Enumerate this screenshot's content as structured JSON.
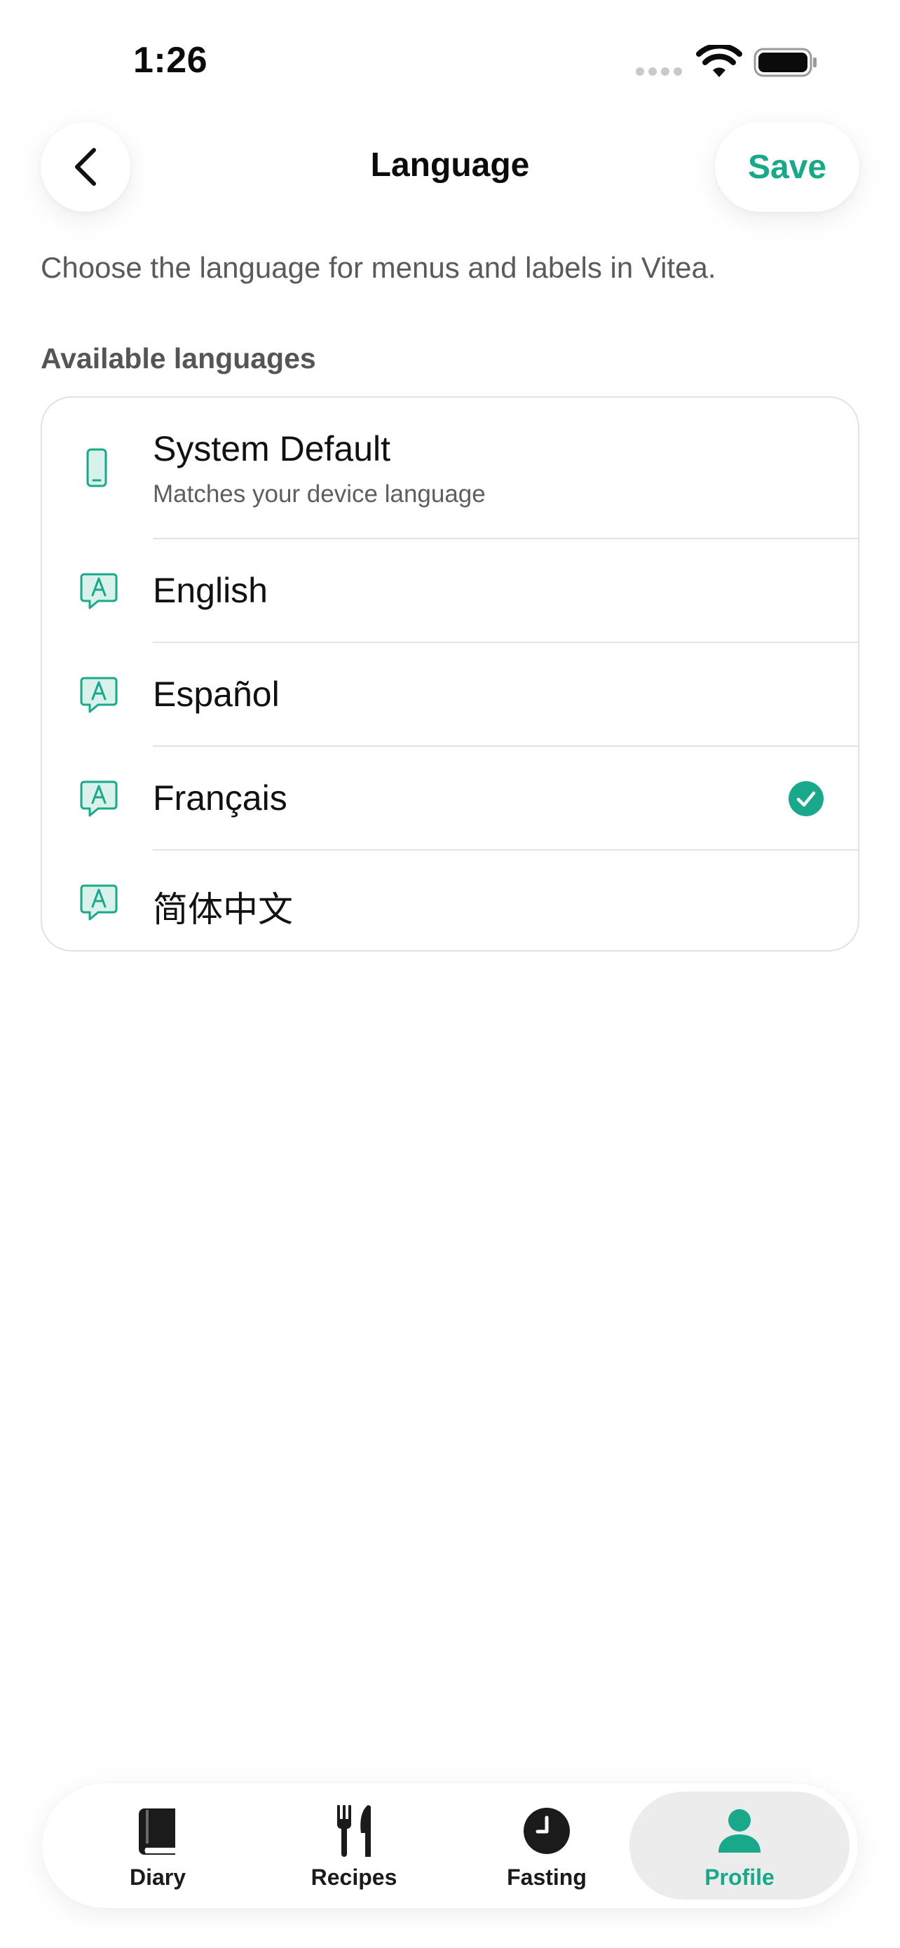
{
  "status_bar": {
    "time": "1:26"
  },
  "header": {
    "title": "Language",
    "save_label": "Save"
  },
  "intro_text": "Choose the language for menus and labels in Vitea.",
  "section_label": "Available languages",
  "languages": [
    {
      "label": "System Default",
      "subtitle": "Matches your device language",
      "icon": "phone-icon",
      "selected": false
    },
    {
      "label": "English",
      "icon": "language-bubble-icon",
      "selected": false
    },
    {
      "label": "Español",
      "icon": "language-bubble-icon",
      "selected": false
    },
    {
      "label": "Français",
      "icon": "language-bubble-icon",
      "selected": true
    },
    {
      "label": "简体中文",
      "icon": "language-bubble-icon",
      "selected": false
    }
  ],
  "tabbar": {
    "tabs": [
      {
        "label": "Diary",
        "icon": "book-icon",
        "active": false
      },
      {
        "label": "Recipes",
        "icon": "fork-knife-icon",
        "active": false
      },
      {
        "label": "Fasting",
        "icon": "clock-icon",
        "active": false
      },
      {
        "label": "Profile",
        "icon": "person-icon",
        "active": true
      }
    ]
  },
  "colors": {
    "accent": "#1aa88a",
    "text": "#111111",
    "muted": "#5a5a5a",
    "divider": "#e3e3e3"
  }
}
